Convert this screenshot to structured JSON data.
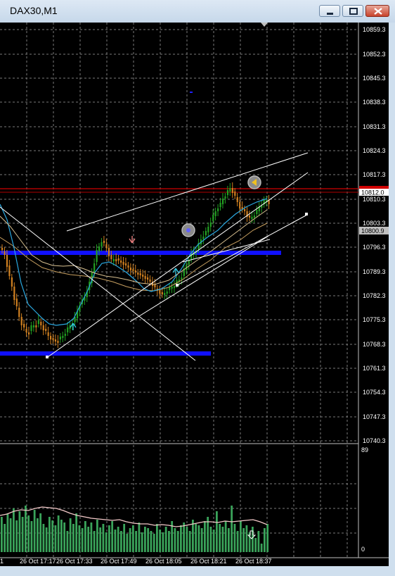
{
  "window": {
    "title": "DAX30,M1",
    "controls": [
      "minimize",
      "maximize",
      "close"
    ]
  },
  "price_axis": {
    "labels": [
      "10859.3",
      "10852.3",
      "10845.3",
      "10838.3",
      "10831.3",
      "10824.3",
      "10817.3",
      "10810.3",
      "10803.3",
      "10796.3",
      "10789.3",
      "10782.3",
      "10775.3",
      "10768.3",
      "10761.3",
      "10754.3",
      "10747.3",
      "10740.3"
    ],
    "current_price_tag": "10812.0",
    "line_price_tag": "10800.9"
  },
  "volume_axis": {
    "max_label": "89",
    "min_label": "0"
  },
  "time_axis": {
    "labels": [
      "1",
      "26 Oct 17:17",
      "26 Oct 17:33",
      "26 Oct 17:49",
      "26 Oct 18:05",
      "26 Oct 18:21",
      "26 Oct 18:37"
    ]
  },
  "colors": {
    "background": "#000000",
    "grid": "#808080",
    "bull_candle": "#22a022",
    "bear_candle": "#d08020",
    "volume_bar": "#3aa35a",
    "support_band": "#1010ff",
    "resistance_line": "#e00000",
    "ma_fast": "#2aa8e0",
    "ma_slow": "#c8a060",
    "trendline": "#ffffff",
    "volume_ma": "#f2c8c8"
  },
  "icons": {
    "window_minimize": "minimize-icon",
    "window_maximize": "maximize-icon",
    "window_close": "close-icon",
    "signal_up": "up-arrow-icon",
    "signal_down": "down-arrow-icon",
    "signal_circle": "target-circle-icon",
    "bottom_arrow": "down-arrow-outline-icon"
  }
}
